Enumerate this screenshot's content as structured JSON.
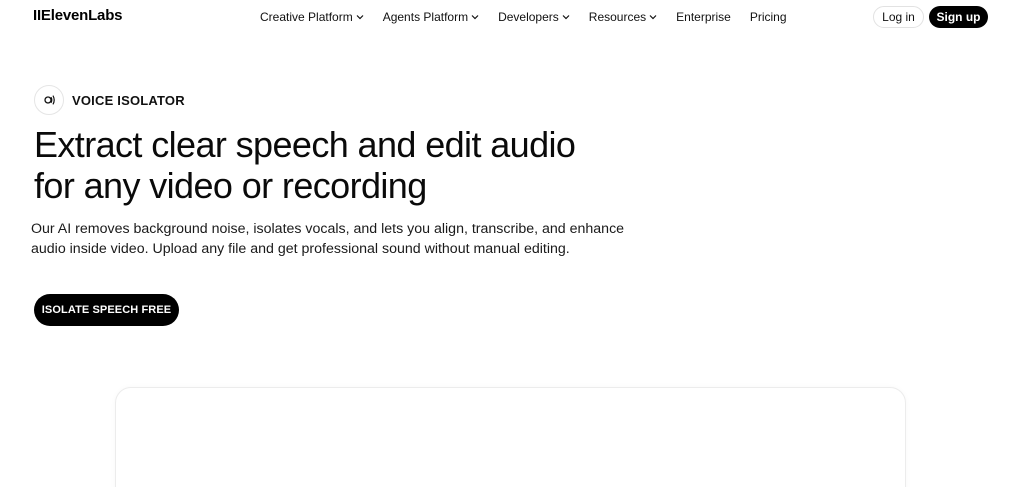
{
  "nav": {
    "logo": "IIElevenLabs",
    "items": [
      {
        "label": "Creative Platform",
        "dropdown": true
      },
      {
        "label": "Agents Platform",
        "dropdown": true
      },
      {
        "label": "Developers",
        "dropdown": true
      },
      {
        "label": "Resources",
        "dropdown": true
      },
      {
        "label": "Enterprise",
        "dropdown": false
      },
      {
        "label": "Pricing",
        "dropdown": false
      }
    ],
    "login_label": "Log in",
    "signup_label": "Sign up"
  },
  "hero": {
    "badge_icon": "sound-wave-icon",
    "badge_label": "VOICE ISOLATOR",
    "headline_line1": "Extract clear speech and edit audio",
    "headline_line2": "for any video or recording",
    "subtext_line1": "Our AI removes background noise, isolates vocals, and lets you align, transcribe, and enhance",
    "subtext_line2": "audio inside video. Upload any file and get professional sound without manual editing.",
    "cta_label": "ISOLATE SPEECH FREE"
  },
  "colors": {
    "primary": "#000000",
    "background": "#ffffff",
    "border": "#e5e5e5"
  }
}
